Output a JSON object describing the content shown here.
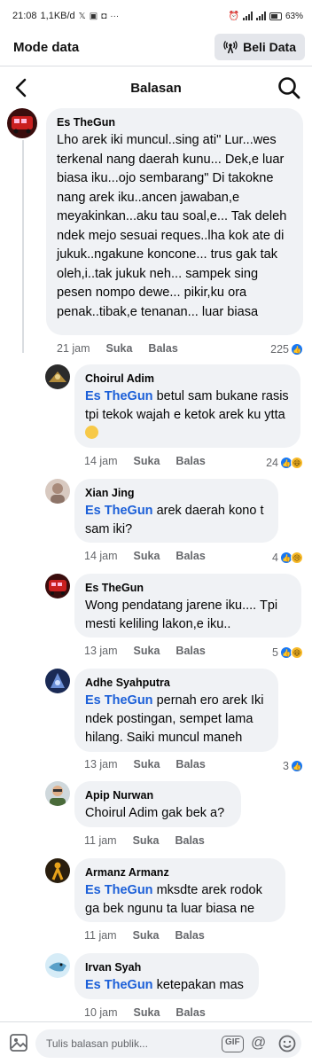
{
  "status_bar": {
    "time": "21:08",
    "speed": "1,1KB/d",
    "battery": "63%"
  },
  "mode_bar": {
    "title": "Mode data",
    "button_label": "Beli Data"
  },
  "header": {
    "title": "Balasan"
  },
  "comments": [
    {
      "author": "Es TheGun",
      "text": "Lho arek iki muncul..sing ati\" Lur...wes terkenal nang daerah kunu... Dek,e luar biasa iku...ojo sembarang\" Di takokne nang arek iku..ancen jawaban,e meyakinkan...aku tau soal,e... Tak deleh ndek mejo sesuai reques..lha kok ate di jukuk..ngakune koncone... trus gak tak oleh,i..tak jukuk neh... sampek   sing pesen nompo dewe... pikir,ku ora penak..tibak,e tenanan... luar biasa",
      "time": "21 jam",
      "like": "Suka",
      "reply": "Balas",
      "reactions": "225"
    },
    {
      "author": "Choirul Adim",
      "mention": "Es TheGun",
      "text": " betul sam bukane rasis tpi tekok wajah e ketok arek ku ytta",
      "time": "14 jam",
      "like": "Suka",
      "reply": "Balas",
      "reactions": "24"
    },
    {
      "author": "Xian Jing",
      "mention": "Es TheGun",
      "text": " arek daerah kono t sam iki?",
      "time": "14 jam",
      "like": "Suka",
      "reply": "Balas",
      "reactions": "4"
    },
    {
      "author": "Es TheGun",
      "text": "Wong pendatang jarene iku.... Tpi mesti keliling lakon,e iku..",
      "time": "13 jam",
      "like": "Suka",
      "reply": "Balas",
      "reactions": "5"
    },
    {
      "author": "Adhe Syahputra",
      "mention": "Es TheGun",
      "text": " pernah ero arek Iki ndek postingan, sempet lama hilang. Saiki muncul maneh",
      "time": "13 jam",
      "like": "Suka",
      "reply": "Balas",
      "reactions": "3"
    },
    {
      "author": "Apip Nurwan",
      "text": "Choirul Adim gak bek a?",
      "time": "11 jam",
      "like": "Suka",
      "reply": "Balas"
    },
    {
      "author": "Armanz Armanz",
      "mention": "Es TheGun",
      "text": " mksdte arek rodok ga bek ngunu ta luar biasa ne",
      "time": "11 jam",
      "like": "Suka",
      "reply": "Balas"
    },
    {
      "author": "Irvan Syah",
      "mention": "Es TheGun",
      "text": " ketepakan mas",
      "time": "10 jam",
      "like": "Suka",
      "reply": "Balas"
    }
  ],
  "composer": {
    "placeholder": "Tulis balasan publik...",
    "gif_label": "GIF"
  },
  "colors": {
    "mention": "#1b5fd8",
    "bubble": "#f0f2f5",
    "like_blue": "#1877f2"
  }
}
